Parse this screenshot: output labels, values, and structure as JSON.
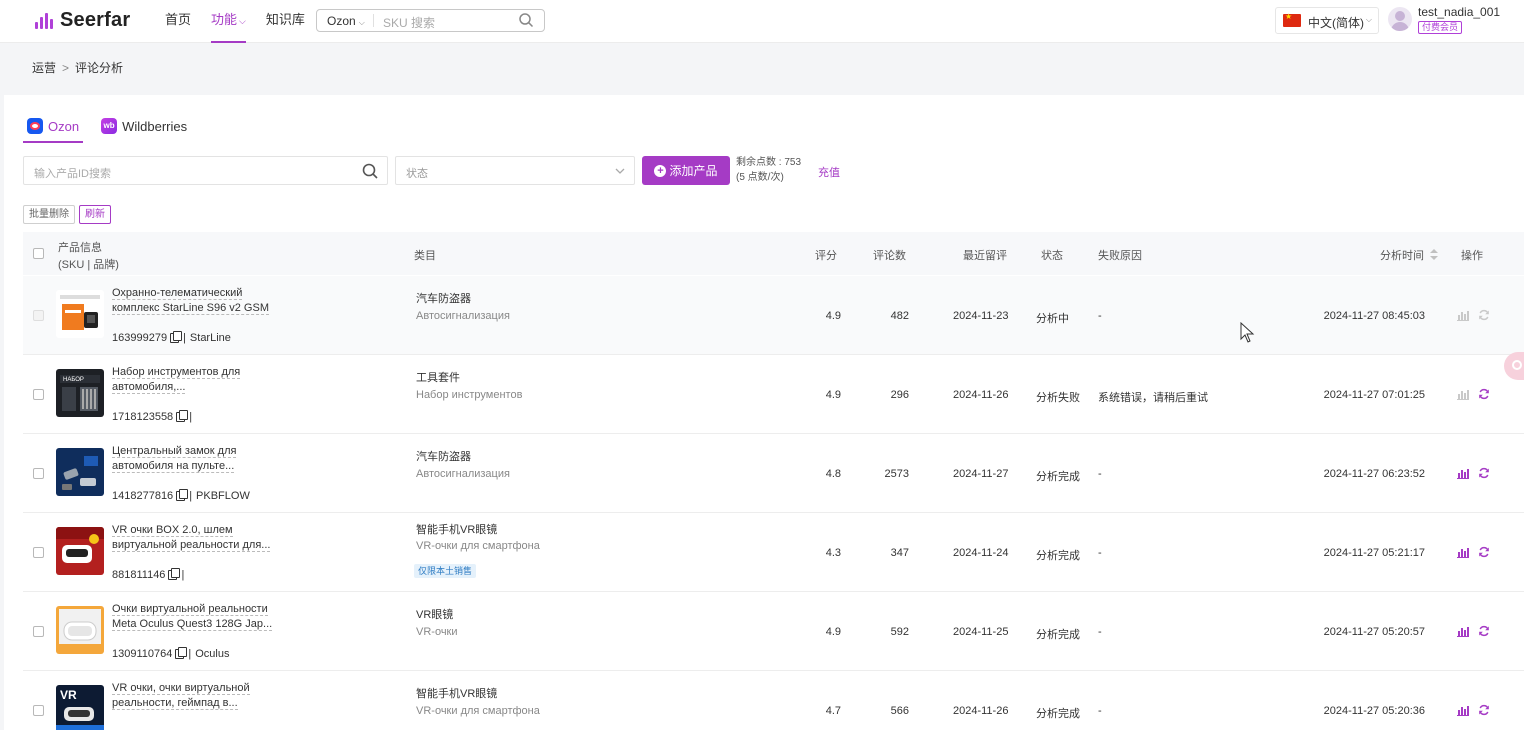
{
  "header": {
    "brand": "Seerfar",
    "nav": [
      {
        "label": "首页"
      },
      {
        "label": "功能",
        "active": true
      },
      {
        "label": "知识库"
      }
    ],
    "search": {
      "marketplace": "Ozon",
      "placeholder": "SKU 搜索"
    },
    "language": "中文(简体)",
    "username": "test_nadia_001",
    "member_badge": "付费会员"
  },
  "breadcrumb": {
    "parent": "运营",
    "current": "评论分析"
  },
  "tabs": [
    {
      "label": "Ozon",
      "active": true
    },
    {
      "label": "Wildberries"
    }
  ],
  "toolbar": {
    "search_placeholder": "输入产品ID搜索",
    "status_placeholder": "状态",
    "add_button": "添加产品",
    "points_line1": "剩余点数 : 753",
    "points_line2": "(5 点数/次)",
    "recharge": "充值",
    "batch_delete": "批量删除",
    "refresh": "刷新"
  },
  "table": {
    "headers": {
      "product_line1": "产品信息",
      "product_line2": "(SKU | 品牌)",
      "category": "类目",
      "rating": "评分",
      "reviews": "评论数",
      "last_review": "最近留评",
      "status": "状态",
      "fail_reason": "失败原因",
      "analysis_time": "分析时间",
      "actions": "操作"
    },
    "rows": [
      {
        "name1": "Охранно-телематический",
        "name2": "комплекс StarLine S96 v2 GSM",
        "sku": "163999279",
        "brand": "StarLine",
        "cat_cn": "汽车防盗器",
        "cat_ru": "Автосигнализация",
        "badge": "",
        "rating": "4.9",
        "reviews": "482",
        "last_review": "2024-11-23",
        "status": "分析中",
        "reason": "-",
        "time": "2024-11-27 08:45:03",
        "disabled": true
      },
      {
        "name1": "Набор инструментов для",
        "name2": "автомобиля,...",
        "sku": "1718123558",
        "brand": "",
        "cat_cn": "工具套件",
        "cat_ru": "Набор инструментов",
        "badge": "",
        "rating": "4.9",
        "reviews": "296",
        "last_review": "2024-11-26",
        "status": "分析失败",
        "reason": "系统错误，请稍后重试",
        "time": "2024-11-27 07:01:25",
        "disabled": false
      },
      {
        "name1": "Центральный замок для",
        "name2": "автомобиля на пульте...",
        "sku": "1418277816",
        "brand": "PKBFLOW",
        "cat_cn": "汽车防盗器",
        "cat_ru": "Автосигнализация",
        "badge": "",
        "rating": "4.8",
        "reviews": "2573",
        "last_review": "2024-11-27",
        "status": "分析完成",
        "reason": "-",
        "time": "2024-11-27 06:23:52",
        "disabled": false
      },
      {
        "name1": "VR очки BOX 2.0, шлем",
        "name2": "виртуальной реальности для...",
        "sku": "881811146",
        "brand": "",
        "cat_cn": "智能手机VR眼镜",
        "cat_ru": "VR-очки для смартфона",
        "badge": "仅限本土销售",
        "rating": "4.3",
        "reviews": "347",
        "last_review": "2024-11-24",
        "status": "分析完成",
        "reason": "-",
        "time": "2024-11-27 05:21:17",
        "disabled": false
      },
      {
        "name1": "Очки виртуальной реальности",
        "name2": "Meta Oculus Quest3 128G Jap...",
        "sku": "1309110764",
        "brand": "Oculus",
        "cat_cn": "VR眼镜",
        "cat_ru": "VR-очки",
        "badge": "",
        "rating": "4.9",
        "reviews": "592",
        "last_review": "2024-11-25",
        "status": "分析完成",
        "reason": "-",
        "time": "2024-11-27 05:20:57",
        "disabled": false
      },
      {
        "name1": "VR очки, очки виртуальной",
        "name2": "реальности, геймпад в...",
        "sku": "",
        "brand": "",
        "cat_cn": "智能手机VR眼镜",
        "cat_ru": "VR-очки для смартфона",
        "badge": "",
        "rating": "4.7",
        "reviews": "566",
        "last_review": "2024-11-26",
        "status": "分析完成",
        "reason": "-",
        "time": "2024-11-27 05:20:36",
        "disabled": false
      }
    ]
  },
  "colors": {
    "accent": "#a53bc5",
    "badge_bg": "#e5f1fb",
    "badge_text": "#2e7cc3"
  }
}
